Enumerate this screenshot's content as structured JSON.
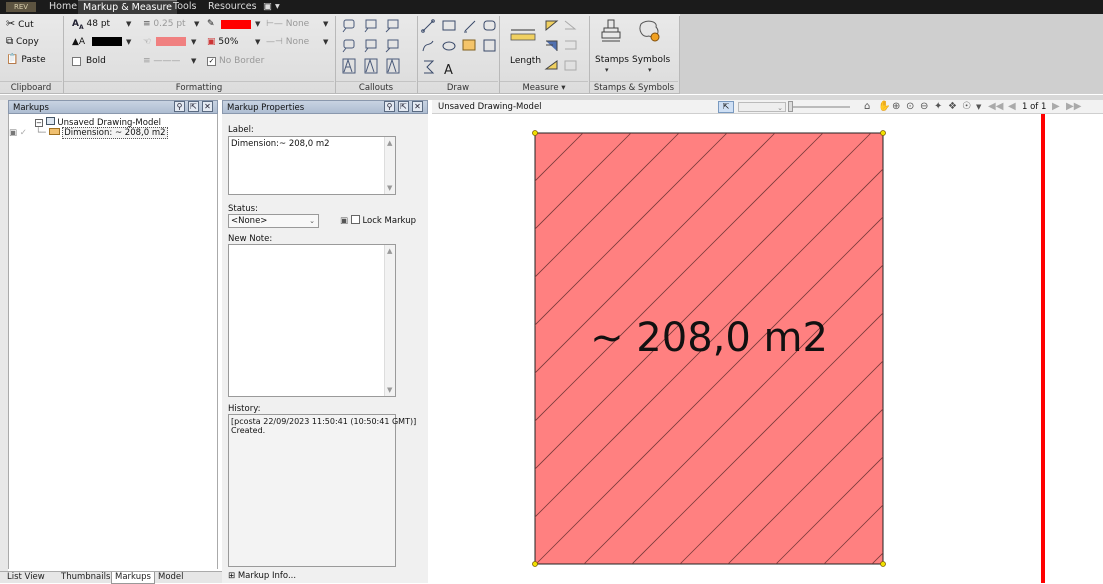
{
  "app": {
    "logo_text": "REV",
    "menu_tabs": [
      "Home",
      "Markup & Measure",
      "Tools",
      "Resources",
      "▣ ▾"
    ],
    "active_tab": "Markup & Measure"
  },
  "ribbon": {
    "clipboard": {
      "cut": "Cut",
      "copy": "Copy",
      "paste": "Paste",
      "footer": "Clipboard"
    },
    "formatting": {
      "font_size": "48 pt",
      "line_weight": "0.25 pt",
      "line_color": "#ff0000",
      "text_color": "#000000",
      "fill_color": "#f08080",
      "transparency": "50%",
      "arrow_start": "None",
      "arrow_end": "None",
      "bold": "Bold",
      "no_border": "No Border",
      "footer": "Formatting"
    },
    "callouts": {
      "footer": "Callouts"
    },
    "draw": {
      "footer": "Draw"
    },
    "measure": {
      "length": "Length",
      "footer": "Measure ▾"
    },
    "stamps": {
      "stamps": "Stamps",
      "symbols": "Symbols",
      "footer": "Stamps & Symbols"
    }
  },
  "markups_pane": {
    "title": "Markups",
    "tree_root": "Unsaved Drawing-Model",
    "tree_child": "Dimension: ~ 208,0 m2",
    "bottom_tabs": [
      "List View",
      "Thumbnails",
      "Markups",
      "Model"
    ],
    "active_bottom_tab": "Markups"
  },
  "properties_pane": {
    "title": "Markup Properties",
    "label_caption": "Label:",
    "label_value": "Dimension:~ 208,0 m2",
    "status_caption": "Status:",
    "status_value": "<None>",
    "lock_label": "Lock Markup",
    "new_note_caption": "New Note:",
    "history_caption": "History:",
    "history_lines": [
      "[pcosta  22/09/2023  11:50:41  (10:50:41 GMT)]",
      "Created."
    ],
    "markup_info": "⊞  Markup Info..."
  },
  "canvas": {
    "title": "Unsaved Drawing-Model",
    "page_indicator": "1 of 1",
    "dimension_text": "~ 208,0 m2",
    "fill_color": "#ff8080",
    "hatch_color": "#7a3a3a",
    "border_line_color": "#ff0000"
  }
}
